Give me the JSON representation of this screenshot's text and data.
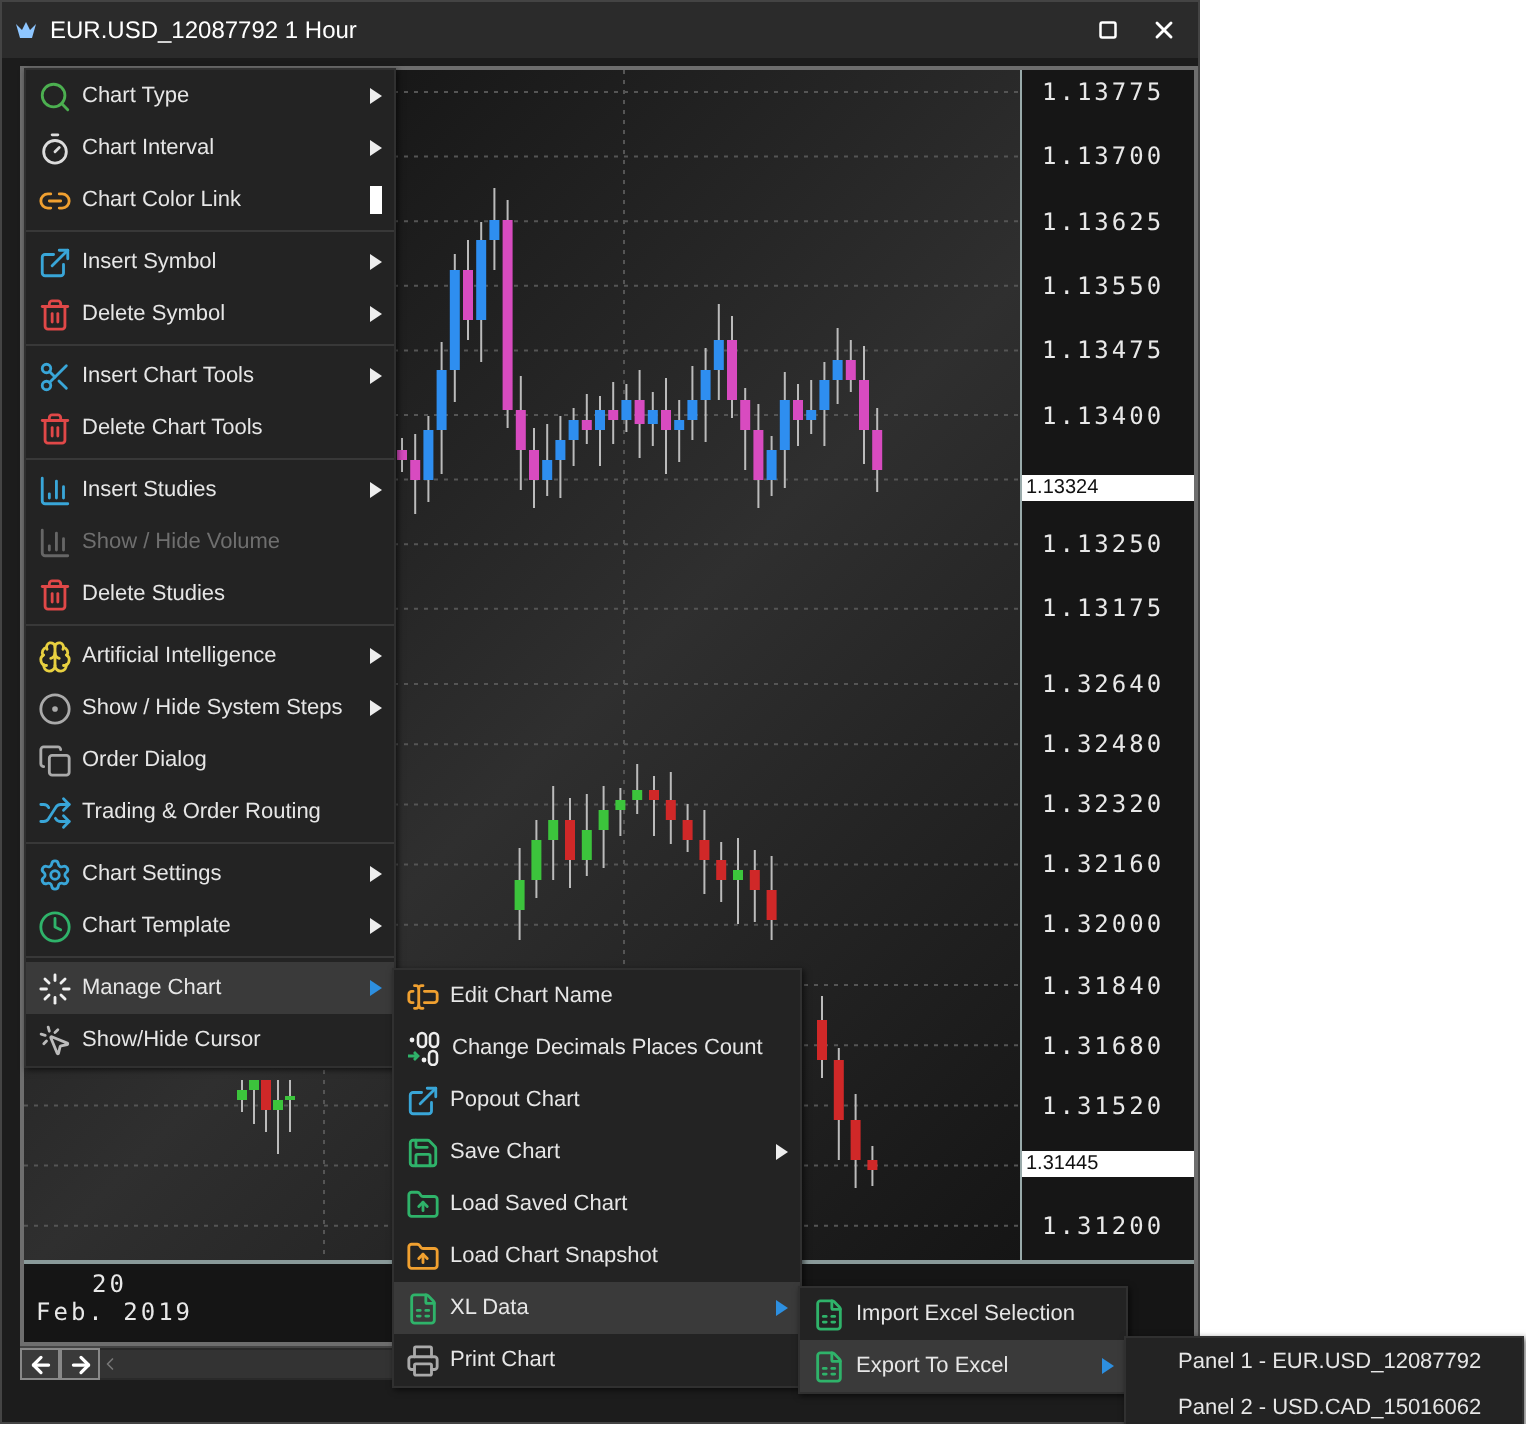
{
  "window": {
    "title": "EUR.USD_12087792 1 Hour"
  },
  "chart": {
    "price_axis": {
      "upper": [
        "1.13775",
        "1.13700",
        "1.13625",
        "1.13550",
        "1.13475",
        "1.13400",
        "1.13250",
        "1.13175"
      ],
      "lower": [
        "1.32640",
        "1.32480",
        "1.32320",
        "1.32160",
        "1.32000",
        "1.31840",
        "1.31680",
        "1.31520",
        "1.31200"
      ]
    },
    "price_tags": [
      "1.13324",
      "1.31445"
    ],
    "time_axis": {
      "day": "20",
      "month": "Feb. 2019"
    }
  },
  "context_menu": {
    "groups": [
      {
        "items": [
          {
            "label": "Chart Type",
            "kind": "submenu",
            "selected": false,
            "disabled": false
          },
          {
            "label": "Chart Interval",
            "kind": "submenu",
            "selected": false,
            "disabled": false
          },
          {
            "label": "Chart Color Link",
            "kind": "swatch",
            "color": "#ffffff",
            "selected": false,
            "disabled": false
          }
        ]
      },
      {
        "items": [
          {
            "label": "Insert Symbol",
            "kind": "submenu",
            "selected": false,
            "disabled": false
          },
          {
            "label": "Delete Symbol",
            "kind": "submenu",
            "selected": false,
            "disabled": false
          }
        ]
      },
      {
        "items": [
          {
            "label": "Insert Chart Tools",
            "kind": "submenu",
            "selected": false,
            "disabled": false
          },
          {
            "label": "Delete Chart Tools",
            "kind": "action",
            "selected": false,
            "disabled": false
          }
        ]
      },
      {
        "items": [
          {
            "label": "Insert Studies",
            "kind": "submenu",
            "selected": false,
            "disabled": false
          },
          {
            "label": "Show / Hide Volume",
            "kind": "action",
            "selected": false,
            "disabled": true
          },
          {
            "label": "Delete Studies",
            "kind": "action",
            "selected": false,
            "disabled": false
          }
        ]
      },
      {
        "items": [
          {
            "label": "Artificial Intelligence",
            "kind": "submenu",
            "selected": false,
            "disabled": false
          },
          {
            "label": "Show / Hide System Steps",
            "kind": "submenu",
            "selected": false,
            "disabled": false
          },
          {
            "label": "Order Dialog",
            "kind": "action",
            "selected": false,
            "disabled": false
          },
          {
            "label": "Trading & Order Routing",
            "kind": "action",
            "selected": false,
            "disabled": false
          }
        ]
      },
      {
        "items": [
          {
            "label": "Chart Settings",
            "kind": "submenu",
            "selected": false,
            "disabled": false
          },
          {
            "label": "Chart Template",
            "kind": "submenu",
            "selected": false,
            "disabled": false
          }
        ]
      },
      {
        "items": [
          {
            "label": "Manage Chart",
            "kind": "submenu",
            "selected": true,
            "disabled": false
          },
          {
            "label": "Show/Hide Cursor",
            "kind": "action",
            "selected": false,
            "disabled": false
          }
        ]
      }
    ]
  },
  "manage_chart_menu": {
    "items": [
      {
        "label": "Edit Chart Name",
        "kind": "action",
        "selected": false
      },
      {
        "label": "Change Decimals Places Count",
        "kind": "action",
        "selected": false
      },
      {
        "label": "Popout Chart",
        "kind": "action",
        "selected": false
      },
      {
        "label": "Save Chart",
        "kind": "submenu",
        "selected": false
      },
      {
        "label": "Load Saved Chart",
        "kind": "action",
        "selected": false
      },
      {
        "label": "Load Chart Snapshot",
        "kind": "action",
        "selected": false
      },
      {
        "label": "XL Data",
        "kind": "submenu",
        "selected": true
      },
      {
        "label": "Print Chart",
        "kind": "action",
        "selected": false
      }
    ]
  },
  "xl_data_menu": {
    "items": [
      {
        "label": "Import Excel Selection",
        "kind": "action",
        "selected": false
      },
      {
        "label": "Export To Excel",
        "kind": "submenu",
        "selected": true
      }
    ]
  },
  "export_menu": {
    "items": [
      {
        "label": "Panel 1 - EUR.USD_12087792",
        "selected": false
      },
      {
        "label": "Panel 2 - USD.CAD_15016062",
        "selected": false
      }
    ]
  }
}
